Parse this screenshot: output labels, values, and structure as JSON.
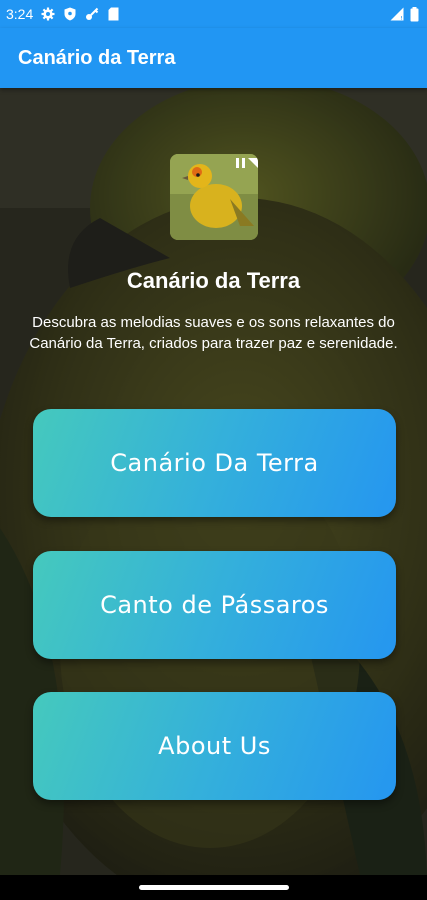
{
  "status_bar": {
    "time": "3:24",
    "icons": [
      "gear-icon",
      "shield-icon",
      "key-icon",
      "sd-card-icon"
    ],
    "right_icons": [
      "signal-icon",
      "battery-icon"
    ]
  },
  "app_bar": {
    "title": "Canário da Terra"
  },
  "hero": {
    "title": "Canário da Terra",
    "description": "Descubra as melodias suaves e os sons relaxantes do Canário da Terra, criados para trazer paz e serenidade."
  },
  "buttons": [
    {
      "label": "Canário Da Terra"
    },
    {
      "label": "Canto de Pássaros"
    },
    {
      "label": "About Us"
    }
  ],
  "colors": {
    "primary": "#2196F3",
    "button_gradient_start": "#45c9bd",
    "button_gradient_end": "#2596f0"
  }
}
